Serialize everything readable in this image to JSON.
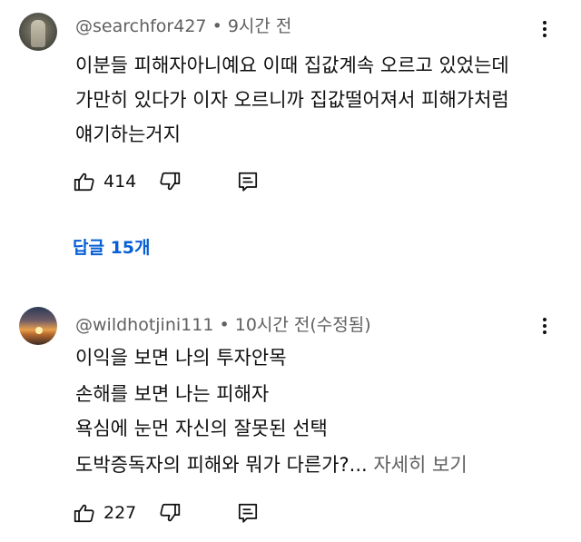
{
  "comments": [
    {
      "author": "@searchfor427",
      "separator": "•",
      "time": "9시간 전",
      "lines": [
        "이분들 피해자아니예요 이때 집값계속 오르고 있었는데",
        "가만히 있다가 이자 오르니까 집값떨어져서 피해가처럼",
        "얘기하는거지"
      ],
      "likes": "414",
      "replies_label": "답글 15개"
    },
    {
      "author": "@wildhotjini111",
      "separator": "•",
      "time": "10시간 전(수정됨)",
      "lines": [
        "이익을 보면 나의 투자안목",
        "손해를 보면 나는 피해자",
        "욕심에 눈먼 자신의 잘못된 선택",
        "도박증독자의 피해와 뭐가 다른가?..."
      ],
      "more_label": " 자세히 보기",
      "likes": "227"
    }
  ],
  "colors": {
    "text": "#0f0f0f",
    "meta": "#606060",
    "link": "#065fd4"
  },
  "icons": [
    "thumbs-up-icon",
    "thumbs-down-icon",
    "reply-icon",
    "more-vert-icon"
  ]
}
